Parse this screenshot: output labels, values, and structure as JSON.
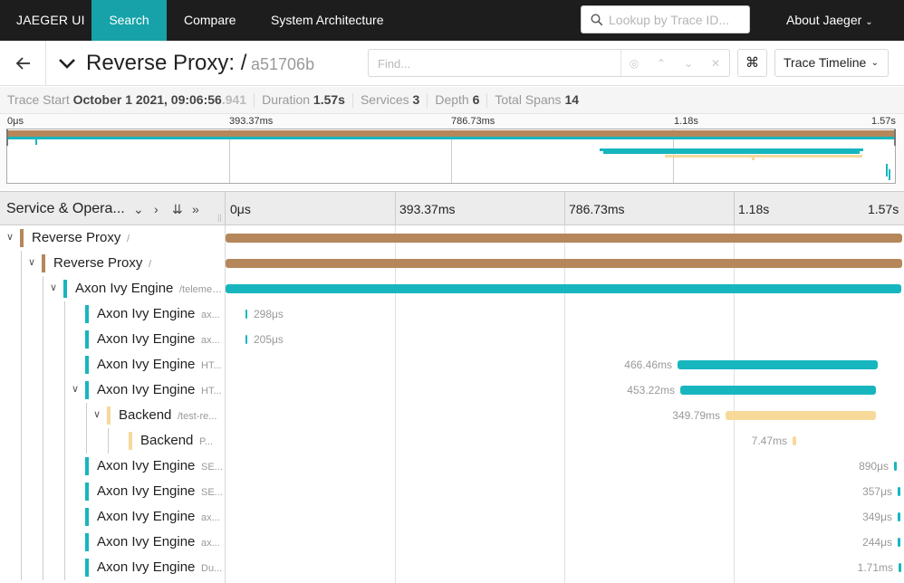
{
  "nav": {
    "brand": "JAEGER UI",
    "items": [
      "Search",
      "Compare",
      "System Architecture"
    ],
    "lookup_placeholder": "Lookup by Trace ID...",
    "about": "About Jaeger"
  },
  "header": {
    "title": "Reverse Proxy: /",
    "trace_id": "a51706b",
    "find_placeholder": "Find...",
    "keyboard_icon": "⌘",
    "view_mode": "Trace Timeline"
  },
  "summary": {
    "trace_start_label": "Trace Start",
    "trace_start_value": "October 1 2021, 09:06:56",
    "trace_start_ms": ".941",
    "duration_label": "Duration",
    "duration_value": "1.57s",
    "services_label": "Services",
    "services_value": "3",
    "depth_label": "Depth",
    "depth_value": "6",
    "total_spans_label": "Total Spans",
    "total_spans_value": "14"
  },
  "minimap_ticks": [
    "0μs",
    "393.37ms",
    "786.73ms",
    "1.18s",
    "1.57s"
  ],
  "timeline": {
    "column_label": "Service & Opera...",
    "ticks": [
      "0μs",
      "393.37ms",
      "786.73ms",
      "1.18s",
      "1.57s"
    ]
  },
  "colors": {
    "proxy": "#b5875a",
    "engine": "#17b6bf",
    "backend": "#f7d99a"
  },
  "spans": [
    {
      "service": "Reverse Proxy",
      "op": "/",
      "depth": 0,
      "expanded": true,
      "color": "proxy",
      "duration_label": ""
    },
    {
      "service": "Reverse Proxy",
      "op": "/",
      "depth": 1,
      "expanded": true,
      "color": "proxy",
      "duration_label": ""
    },
    {
      "service": "Axon Ivy Engine",
      "op": "/telemet...",
      "depth": 2,
      "expanded": true,
      "color": "engine",
      "duration_label": ""
    },
    {
      "service": "Axon Ivy Engine",
      "op": "ax...",
      "depth": 3,
      "expanded": null,
      "color": "engine",
      "duration_label": "298μs"
    },
    {
      "service": "Axon Ivy Engine",
      "op": "ax...",
      "depth": 3,
      "expanded": null,
      "color": "engine",
      "duration_label": "205μs"
    },
    {
      "service": "Axon Ivy Engine",
      "op": "HT...",
      "depth": 3,
      "expanded": null,
      "color": "engine",
      "duration_label": "466.46ms"
    },
    {
      "service": "Axon Ivy Engine",
      "op": "HT...",
      "depth": 3,
      "expanded": true,
      "color": "engine",
      "duration_label": "453.22ms"
    },
    {
      "service": "Backend",
      "op": "/test-re...",
      "depth": 4,
      "expanded": true,
      "color": "backend",
      "duration_label": "349.79ms"
    },
    {
      "service": "Backend",
      "op": "P...",
      "depth": 5,
      "expanded": null,
      "color": "backend",
      "duration_label": "7.47ms"
    },
    {
      "service": "Axon Ivy Engine",
      "op": "SE...",
      "depth": 3,
      "expanded": null,
      "color": "engine",
      "duration_label": "890μs"
    },
    {
      "service": "Axon Ivy Engine",
      "op": "SE...",
      "depth": 3,
      "expanded": null,
      "color": "engine",
      "duration_label": "357μs"
    },
    {
      "service": "Axon Ivy Engine",
      "op": "ax...",
      "depth": 3,
      "expanded": null,
      "color": "engine",
      "duration_label": "349μs"
    },
    {
      "service": "Axon Ivy Engine",
      "op": "ax...",
      "depth": 3,
      "expanded": null,
      "color": "engine",
      "duration_label": "244μs"
    },
    {
      "service": "Axon Ivy Engine",
      "op": "Du...",
      "depth": 3,
      "expanded": null,
      "color": "engine",
      "duration_label": "1.71ms"
    }
  ]
}
